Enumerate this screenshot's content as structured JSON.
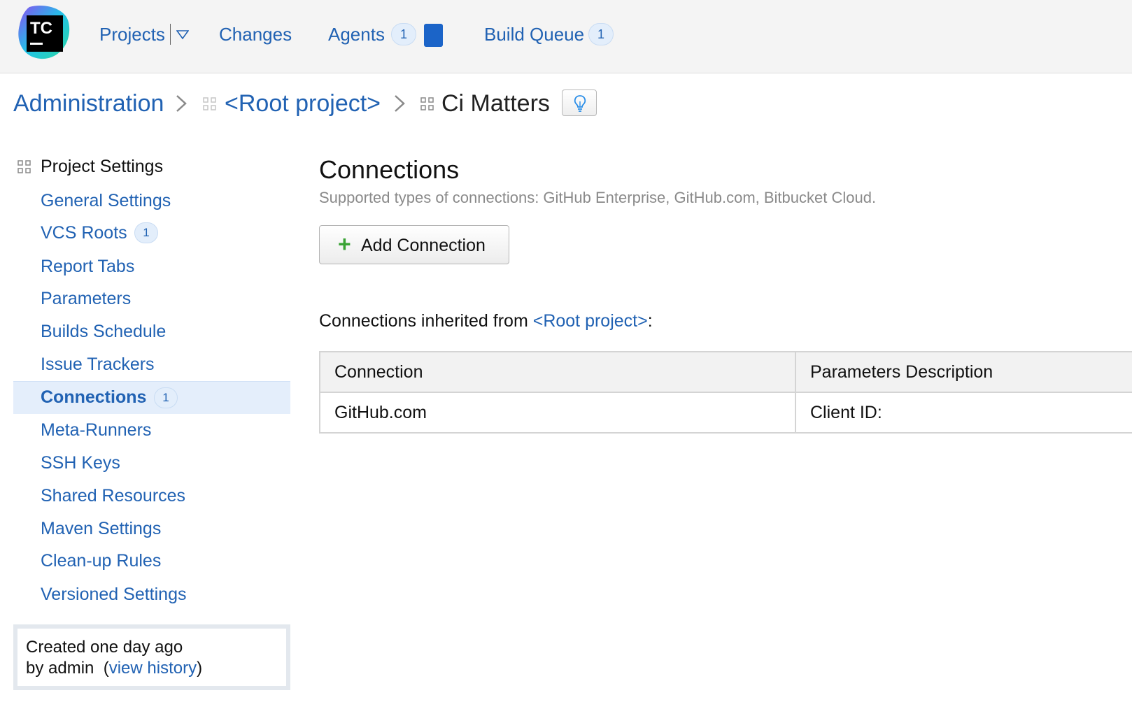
{
  "topnav": {
    "logo_text": "TC",
    "projects": "Projects",
    "changes": "Changes",
    "agents": "Agents",
    "agents_count": "1",
    "build_queue": "Build Queue",
    "build_queue_count": "1"
  },
  "breadcrumb": {
    "administration": "Administration",
    "root_project": "<Root project>",
    "current": "Ci Matters"
  },
  "sidebar": {
    "heading": "Project Settings",
    "items": [
      {
        "label": "General Settings"
      },
      {
        "label": "VCS Roots",
        "badge": "1"
      },
      {
        "label": "Report Tabs"
      },
      {
        "label": "Parameters"
      },
      {
        "label": "Builds Schedule"
      },
      {
        "label": "Issue Trackers"
      },
      {
        "label": "Connections",
        "badge": "1",
        "active": true
      },
      {
        "label": "Meta-Runners"
      },
      {
        "label": "SSH Keys"
      },
      {
        "label": "Shared Resources"
      },
      {
        "label": "Maven Settings"
      },
      {
        "label": "Clean-up Rules"
      },
      {
        "label": "Versioned Settings"
      }
    ],
    "created_line": "Created one day ago",
    "by_line": "by admin",
    "view_history": "view history"
  },
  "main": {
    "title": "Connections",
    "subtitle": "Supported types of connections: GitHub Enterprise, GitHub.com, Bitbucket Cloud.",
    "add_button": "Add Connection",
    "inherited_prefix": "Connections inherited from ",
    "inherited_link": "<Root project>",
    "inherited_suffix": ":",
    "table": {
      "headers": [
        "Connection",
        "Parameters Description"
      ],
      "rows": [
        [
          "GitHub.com",
          "Client ID:"
        ]
      ]
    }
  },
  "colors": {
    "link": "#2162b3",
    "agent_status": "#1b64c8",
    "add_icon": "#3aa335",
    "active_row": "#e4eefb"
  },
  "icons": [
    "teamcity-logo-icon",
    "dropdown-caret-icon",
    "chevron-right-icon",
    "project-grid-icon",
    "lightbulb-icon",
    "plus-icon"
  ]
}
